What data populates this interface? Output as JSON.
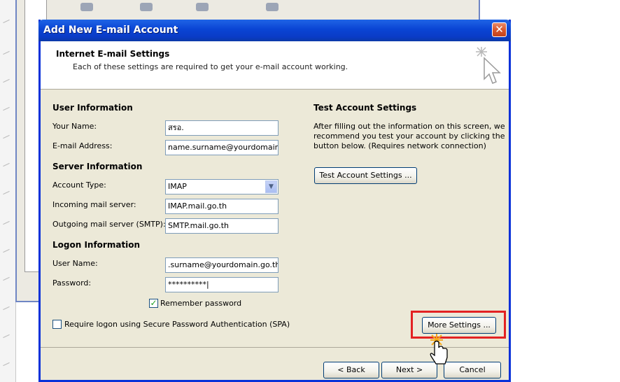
{
  "dialog": {
    "title": "Add New E-mail Account",
    "close_glyph": "✕",
    "header_title": "Internet E-mail Settings",
    "header_subtitle": "Each of these settings are required to get your e-mail account working."
  },
  "user_information": {
    "heading": "User Information",
    "your_name_label": "Your Name:",
    "your_name_value": "สรอ.",
    "email_label": "E-mail Address:",
    "email_value": "name.surname@yourdomain.g"
  },
  "server_information": {
    "heading": "Server Information",
    "account_type_label": "Account Type:",
    "account_type_value": "IMAP",
    "incoming_label": "Incoming mail server:",
    "incoming_value": "IMAP.mail.go.th",
    "outgoing_label": "Outgoing mail server (SMTP):",
    "outgoing_value": "SMTP.mail.go.th"
  },
  "logon_information": {
    "heading": "Logon Information",
    "username_label": "User Name:",
    "username_value": ".surname@yourdomain.go.th",
    "password_label": "Password:",
    "password_value": "**********|",
    "remember_label": "Remember password",
    "remember_checked": true,
    "spa_label": "Require logon using Secure Password Authentication (SPA)",
    "spa_checked": false
  },
  "test_settings": {
    "heading": "Test Account Settings",
    "line1": "After filling out the information on this screen, we",
    "line2": "recommend you test your account by clicking the",
    "line3": "button below. (Requires network connection)",
    "button_label": "Test Account Settings ..."
  },
  "buttons": {
    "more_settings": "More Settings ...",
    "back": "< Back",
    "next": "Next >",
    "cancel": "Cancel"
  },
  "colors": {
    "titlebar": "#0a44d4",
    "dialog_bg": "#ece9d8",
    "highlight": "#e32222"
  },
  "icons": [
    "wizard-cursor-icon",
    "close-icon",
    "dropdown-arrow-icon",
    "checkmark-icon",
    "hand-cursor-icon"
  ]
}
